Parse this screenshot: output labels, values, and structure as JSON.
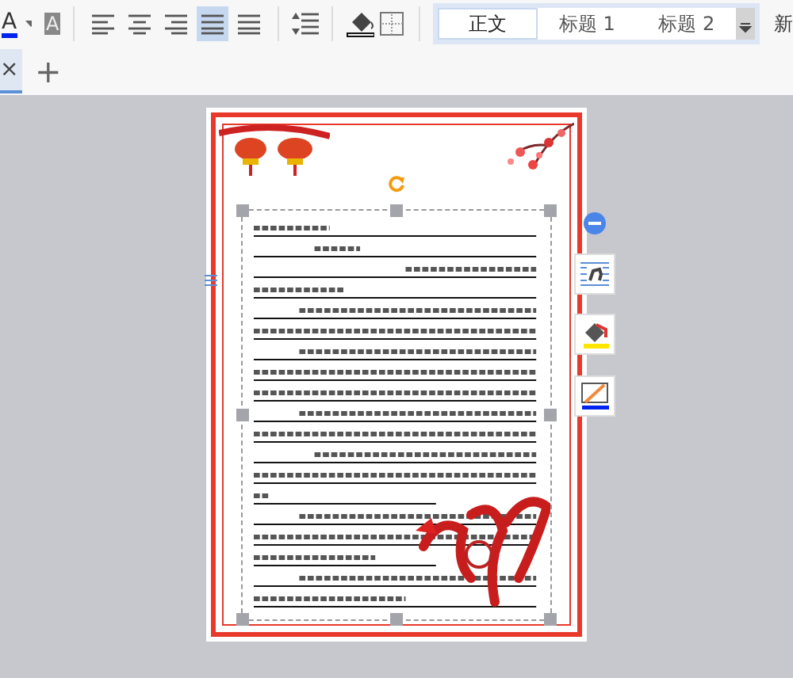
{
  "toolbar": {
    "font_color_glyph": "A",
    "highlight_glyph": "A",
    "alignments": [
      {
        "selected": false
      },
      {
        "selected": false
      },
      {
        "selected": false
      },
      {
        "selected": true
      },
      {
        "selected": false
      }
    ],
    "styles": [
      {
        "label": "正文",
        "selected": true
      },
      {
        "label": "标题 1",
        "selected": false
      },
      {
        "label": "标题 2",
        "selected": false
      }
    ],
    "more_styles_label": "新"
  },
  "tabs": {
    "close": "×",
    "add": "+"
  }
}
